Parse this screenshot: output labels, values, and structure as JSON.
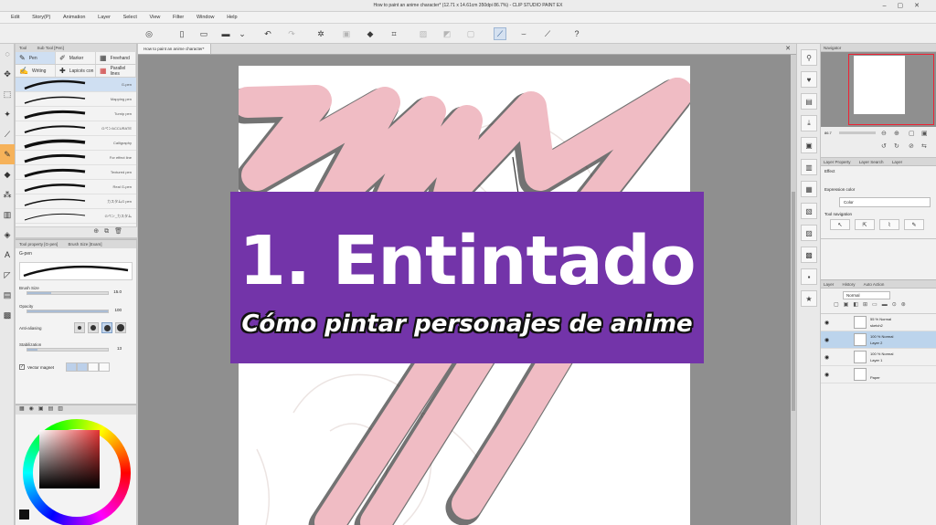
{
  "window": {
    "title": "How to paint an anime character* (12.71 x 14.61cm 350dpi 86.7%) - CLIP STUDIO PAINT EX"
  },
  "menu": [
    "Edit",
    "Story(P)",
    "Animation",
    "Layer",
    "Select",
    "View",
    "Filter",
    "Window",
    "Help"
  ],
  "document_tab": "How to paint an anime character*",
  "subtool_panel": {
    "tabs": [
      "Tool",
      "Sub Tool [Pen]"
    ],
    "categories": [
      {
        "label": "Pen",
        "icon": "pen-icon"
      },
      {
        "label": "Marker",
        "icon": "marker-icon"
      },
      {
        "label": "Freehand",
        "icon": "freehand-icon"
      }
    ],
    "categories2": [
      {
        "label": "Writing",
        "icon": "writing-icon"
      },
      {
        "label": "Lapicés con",
        "icon": "lapiz-icon"
      },
      {
        "label": "Parallel lines",
        "icon": "parallel-icon"
      }
    ],
    "brushes": [
      "G-pen",
      "Mapping pen",
      "Turnip pen",
      "GペンACCURATE",
      "Calligraphy",
      "For effect line",
      "Textured pen",
      "Real G-pen",
      "カスタムG pen",
      "Gペン_カスタム"
    ]
  },
  "tool_property": {
    "tabs": [
      "Tool property [G-pen]",
      "Brush Size [Exam]"
    ],
    "tool_name": "G-pen",
    "brush_size_label": "Brush Size",
    "brush_size_value": "15.0",
    "opacity_label": "Opacity",
    "opacity_value": "100",
    "antialias_label": "Anti-aliasing",
    "stabilization_label": "Stabilization",
    "stabilization_value": "13",
    "vector_magnet_label": "Vector magnet"
  },
  "navigator": {
    "tab": "Navigator",
    "zoom": "86.7"
  },
  "layer_property": {
    "tabs": [
      "Layer Property",
      "Layer Search",
      "Layer"
    ],
    "effect_label": "Effect",
    "expression_label": "Expression color",
    "expression_value": "Color",
    "tool_nav_label": "Tool navigation"
  },
  "layers_panel": {
    "tabs": [
      "Layer",
      "History",
      "Auto Action"
    ],
    "blend_mode": "Normal",
    "layers": [
      {
        "line1": "55 % Normal",
        "line2": "sketch2",
        "selected": false
      },
      {
        "line1": "100 % Normal",
        "line2": "Layer 2",
        "selected": true
      },
      {
        "line1": "100 % Normal",
        "line2": "Layer 1",
        "selected": false
      },
      {
        "line1": "",
        "line2": "Paper",
        "selected": false
      }
    ]
  },
  "banner": {
    "title": "1. Entintado",
    "subtitle": "Cómo pintar personajes de anime"
  },
  "colors": {
    "accent_purple": "#7334a9",
    "pink_stroke": "#f0bcc4",
    "active_tool": "#f6b25a"
  }
}
